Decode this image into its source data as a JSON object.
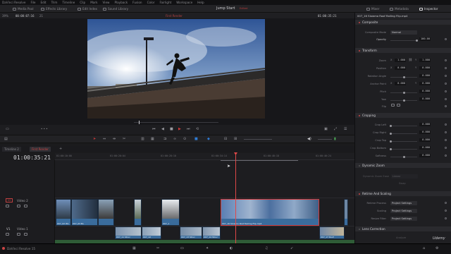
{
  "menubar": {
    "app": "DaVinci Resolve",
    "items": [
      "File",
      "Edit",
      "Trim",
      "Timeline",
      "Clip",
      "Mark",
      "View",
      "Playback",
      "Fusion",
      "Color",
      "Fairlight",
      "Workspace",
      "Help"
    ]
  },
  "toolbar": {
    "media_pool": "Media Pool",
    "effects_library": "Effects Library",
    "edit_index": "Edit Index",
    "sound_library": "Sound Library",
    "project_title": "Jump Start",
    "project_status": "Edited",
    "mixer": "Mixer",
    "metadata": "Metadata",
    "inspector": "Inspector"
  },
  "viewer": {
    "zoom": "39%",
    "timecode_left": "00:00:07:16",
    "frame_count": "21",
    "timeline_name": "First Render",
    "timecode_right": "01:00:35:21",
    "clip_name": "007_16 Slowmo Roof Railing Flip.mp4"
  },
  "timeline": {
    "tabs": [
      "Timeline 2",
      "First Render"
    ],
    "current_timecode": "01:00:35:21",
    "ruler_labels": [
      "01:00:10:00",
      "01:00:20:04",
      "01:00:28:10",
      "01:00:34:14",
      "01:00:40:18",
      "01:00:46:24"
    ],
    "tracks": [
      {
        "id": "V2",
        "name": "Video 2"
      },
      {
        "id": "V1",
        "name": "Video 1"
      }
    ],
    "clips_v2": [
      {
        "name": "007_02 Wo",
        "color": "#3b6fa0"
      },
      {
        "name": "007_03 Bo",
        "color": "#3d6a98"
      },
      {
        "name": "",
        "color": "#3a6c9c"
      },
      {
        "name": "",
        "color": "#3a6c9c"
      },
      {
        "name": "007_1",
        "color": "#3a6c9c"
      },
      {
        "name": "007_16 Slowmo Roof Railing Flip.mp4",
        "color": "#3a6c9c"
      }
    ],
    "clips_v1": [
      {
        "name": "007_11 Struc",
        "color": "#3a6c9c"
      },
      {
        "name": "007_12",
        "color": "#3a6c9c"
      },
      {
        "name": "007_13 Struc",
        "color": "#3a6c9c"
      },
      {
        "name": "007_14 Struc",
        "color": "#3a6c9c"
      },
      {
        "name": "007_17 Roof",
        "color": "#3a6c9c"
      }
    ]
  },
  "inspector": {
    "clip_title": "007_16 Slowmo Roof Railing Flip.mp4",
    "composite": {
      "title": "Composite",
      "mode_label": "Composite Mode",
      "mode_value": "Normal",
      "opacity_label": "Opacity",
      "opacity_value": "100.00"
    },
    "transform": {
      "title": "Transform",
      "zoom_label": "Zoom",
      "zoom_x": "1.000",
      "zoom_y": "1.000",
      "position_label": "Position",
      "position_x": "0.000",
      "position_y": "0.000",
      "rotation_label": "Rotation Angle",
      "rotation_value": "0.000",
      "anchor_label": "Anchor Point",
      "anchor_x": "0.000",
      "anchor_y": "0.000",
      "pitch_label": "Pitch",
      "pitch_value": "0.000",
      "yaw_label": "Yaw",
      "yaw_value": "0.000",
      "flip_label": "Flip"
    },
    "cropping": {
      "title": "Cropping",
      "crop_left_label": "Crop Left",
      "crop_left": "0.000",
      "crop_right_label": "Crop Right",
      "crop_right": "0.000",
      "crop_top_label": "Crop Top",
      "crop_top": "0.000",
      "crop_bottom_label": "Crop Bottom",
      "crop_bottom": "0.000",
      "softness_label": "Softness",
      "softness": "0.000"
    },
    "dynamic_zoom": {
      "title": "Dynamic Zoom",
      "ease_label": "Dynamic Zoom Ease",
      "ease_value": "Linear",
      "swap": "Swap"
    },
    "retime": {
      "title": "Retime And Scaling",
      "process_label": "Retime Process",
      "process_value": "Project Settings",
      "scaling_label": "Scaling",
      "scaling_value": "Project Settings",
      "filter_label": "Resize Filter",
      "filter_value": "Project Settings"
    },
    "lens": {
      "title": "Lens Correction",
      "analyze": "Analyze"
    }
  },
  "bottombar": {
    "app_label": "DaVinci Resolve 15"
  },
  "watermark": "Udemy"
}
